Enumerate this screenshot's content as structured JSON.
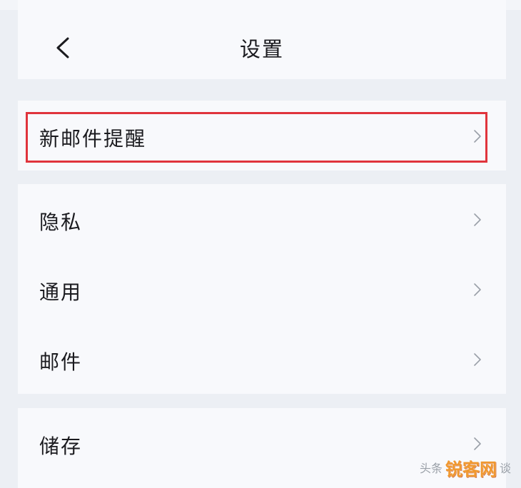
{
  "header": {
    "back_icon": "chevron-left-icon",
    "title": "设置"
  },
  "groups": [
    {
      "items": [
        {
          "label": "新邮件提醒",
          "icon": "chevron-right-icon",
          "highlighted": true
        }
      ]
    },
    {
      "items": [
        {
          "label": "隐私",
          "icon": "chevron-right-icon"
        },
        {
          "label": "通用",
          "icon": "chevron-right-icon"
        },
        {
          "label": "邮件",
          "icon": "chevron-right-icon"
        }
      ]
    },
    {
      "items": [
        {
          "label": "储存",
          "icon": "chevron-right-icon"
        }
      ]
    }
  ],
  "watermark": {
    "prefix": "头条",
    "brand": "锐客网",
    "suffix": "谈"
  },
  "colors": {
    "background": "#eceff4",
    "card": "#f8f9fc",
    "text": "#1b1b1f",
    "chevron": "#9aa0a8",
    "highlight": "#e0343c",
    "brand": "#f0982f"
  }
}
